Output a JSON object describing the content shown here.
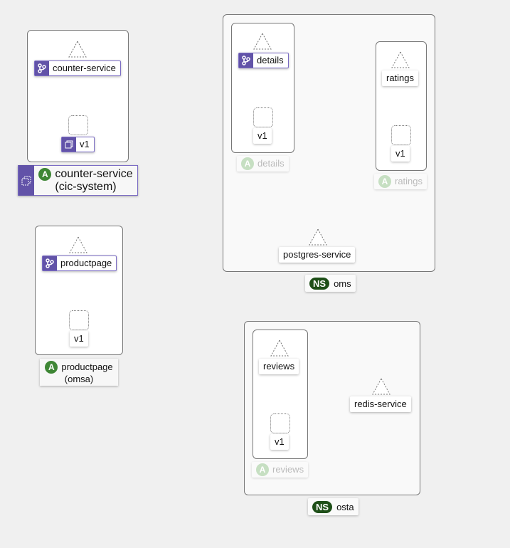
{
  "apps": {
    "counter": {
      "service": "counter-service",
      "version": "v1",
      "app_name": "counter-service",
      "app_namespace": "(cic-system)"
    },
    "productpage": {
      "service": "productpage",
      "version": "v1",
      "app_name": "productpage",
      "app_namespace": "(omsa)"
    },
    "details": {
      "service": "details",
      "version": "v1",
      "app_name": "details"
    },
    "ratings": {
      "service": "ratings",
      "version": "v1",
      "app_name": "ratings"
    },
    "reviews": {
      "service": "reviews",
      "version": "v1",
      "app_name": "reviews"
    }
  },
  "services": {
    "postgres": "postgres-service",
    "redis": "redis-service"
  },
  "namespaces": {
    "oms": "oms",
    "osta": "osta",
    "badge": "NS"
  },
  "app_badge": "A"
}
